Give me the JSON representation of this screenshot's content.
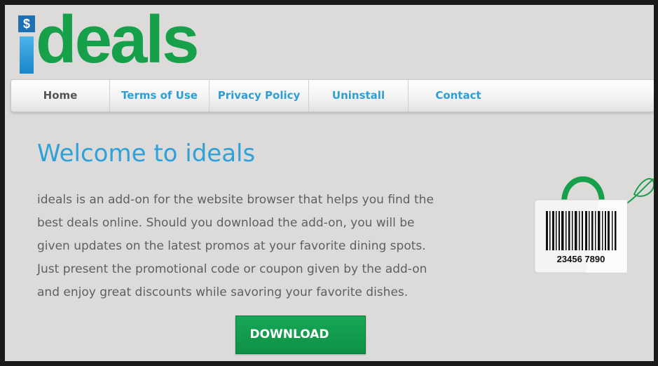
{
  "logo": {
    "text": "ideals",
    "dollar_symbol": "$",
    "colors": {
      "green": "#16a04a",
      "blue": "#2fa1d8"
    }
  },
  "nav": {
    "items": [
      {
        "label": "Home"
      },
      {
        "label": "Terms of Use"
      },
      {
        "label": "Privacy Policy"
      },
      {
        "label": "Uninstall"
      },
      {
        "label": "Contact"
      }
    ]
  },
  "main": {
    "title": "Welcome to ideals",
    "description_lines": [
      "ideals is an add-on for the website browser that helps you find the",
      "best deals online. Should you download the add-on, you will be",
      "given updates on the latest promos at your favorite dining spots.",
      "Just present the promotional code or coupon given by the add-on",
      "and enjoy great discounts while savoring your favorite dishes."
    ],
    "download_label": "DOWNLOAD"
  },
  "bag": {
    "barcode_number": "23456 7890",
    "icon": "shopping-bag-barcode-icon"
  }
}
